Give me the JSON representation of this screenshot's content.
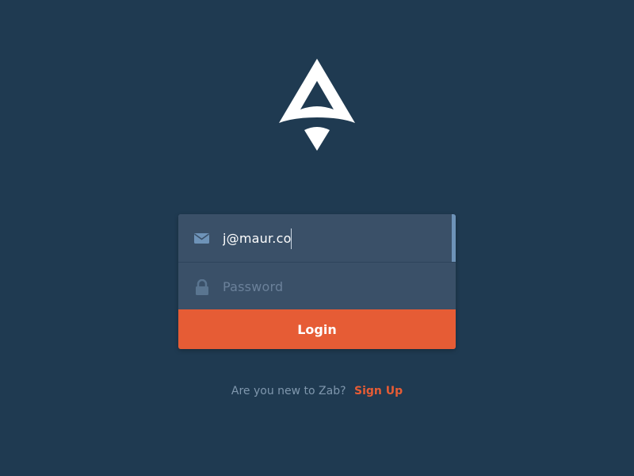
{
  "colors": {
    "background": "#1f3a51",
    "card": "#3a5068",
    "accent": "#e65c35",
    "muted_text": "#7f97ad"
  },
  "logo": {
    "icon": "triangle-a-logo-icon"
  },
  "login_form": {
    "email": {
      "icon": "envelope-icon",
      "value": "j@maur.co"
    },
    "password": {
      "icon": "lock-icon",
      "placeholder": "Password"
    },
    "submit_label": "Login"
  },
  "signup": {
    "prompt": "Are you new to Zab?",
    "link_label": "Sign Up"
  }
}
